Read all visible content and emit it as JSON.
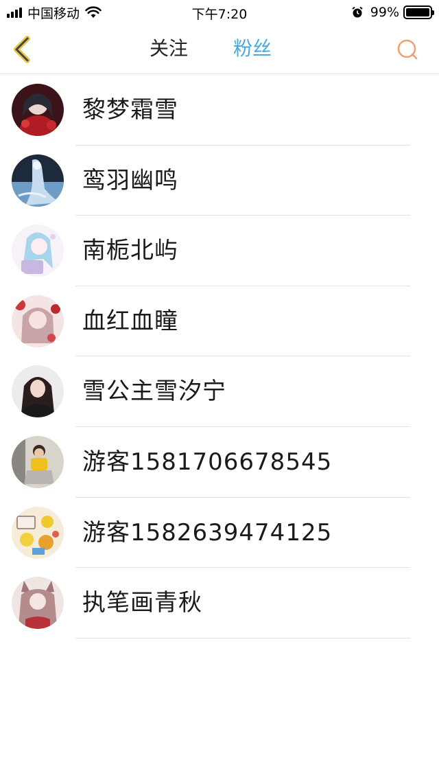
{
  "status_bar": {
    "carrier": "中国移动",
    "time": "下午7:20",
    "battery": "99%",
    "battery_level": 0.99
  },
  "nav": {
    "back_icon": "chevron-left-icon",
    "tabs": [
      {
        "label": "关注",
        "active": false
      },
      {
        "label": "粉丝",
        "active": true
      }
    ],
    "search_icon": "search-icon",
    "accent_color": "#4aa8dc",
    "icon_color": "#f0a070"
  },
  "fans": [
    {
      "name": "黎梦霜雪",
      "avatar": "avatar-anime-red-girl"
    },
    {
      "name": "鸾羽幽鸣",
      "avatar": "avatar-anime-blue-ghost"
    },
    {
      "name": "南栀北屿",
      "avatar": "avatar-anime-light-blue-girl"
    },
    {
      "name": "血红血瞳",
      "avatar": "avatar-anime-pink-girl"
    },
    {
      "name": "雪公主雪汐宁",
      "avatar": "avatar-photo-dark-hair-girl"
    },
    {
      "name": "游客1581706678545",
      "avatar": "avatar-photo-sitting-kid"
    },
    {
      "name": "游客1582639474125",
      "avatar": "avatar-cartoon-pile"
    },
    {
      "name": "执笔画青秋",
      "avatar": "avatar-anime-fox-girl"
    }
  ]
}
